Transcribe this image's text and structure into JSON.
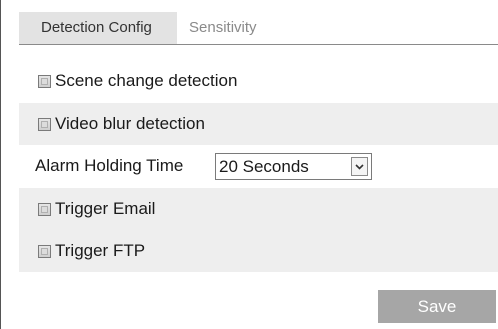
{
  "tabs": [
    {
      "label": "Detection Config",
      "active": true
    },
    {
      "label": "Sensitivity",
      "active": false
    }
  ],
  "options": {
    "scene_change": {
      "label": "Scene change detection",
      "checked": false
    },
    "video_blur": {
      "label": "Video blur detection",
      "checked": false
    },
    "trigger_email": {
      "label": "Trigger Email",
      "checked": false
    },
    "trigger_ftp": {
      "label": "Trigger FTP",
      "checked": false
    }
  },
  "alarm_holding": {
    "label": "Alarm Holding Time",
    "value": "20 Seconds"
  },
  "save_label": "Save",
  "colors": {
    "active_tab_bg": "#e3e3e3",
    "row_shade": "#eeeeee",
    "save_button_bg": "#a6a6a6"
  }
}
